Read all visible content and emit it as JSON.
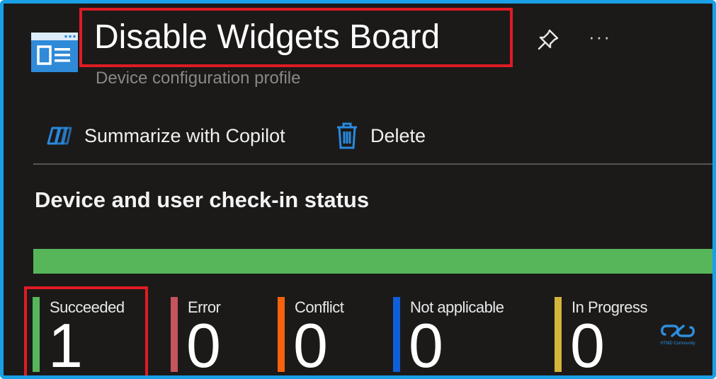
{
  "header": {
    "title": "Disable Widgets Board",
    "subtitle": "Device configuration profile",
    "more_glyph": "···",
    "icons": {
      "profile": "device-profile-icon",
      "pin": "pin-icon",
      "more": "more-options-icon"
    }
  },
  "toolbar": {
    "summarize_label": "Summarize with Copilot",
    "delete_label": "Delete"
  },
  "checkin": {
    "section_title": "Device and user check-in status",
    "succeeded_fraction": 1.0,
    "stats": [
      {
        "label": "Succeeded",
        "count": "1",
        "color": "#57b65a"
      },
      {
        "label": "Error",
        "count": "0",
        "color": "#c4545e"
      },
      {
        "label": "Conflict",
        "count": "0",
        "color": "#f7630c"
      },
      {
        "label": "Not applicable",
        "count": "0",
        "color": "#0f5fd8"
      },
      {
        "label": "In Progress",
        "count": "0",
        "color": "#d4b53a"
      }
    ]
  },
  "watermark": {
    "text": "HTMD Community"
  },
  "colors": {
    "frame_border": "#1aa0e6",
    "highlight_box": "#e01b24",
    "background": "#1b1a19",
    "accent_icon": "#2a8ae0"
  }
}
